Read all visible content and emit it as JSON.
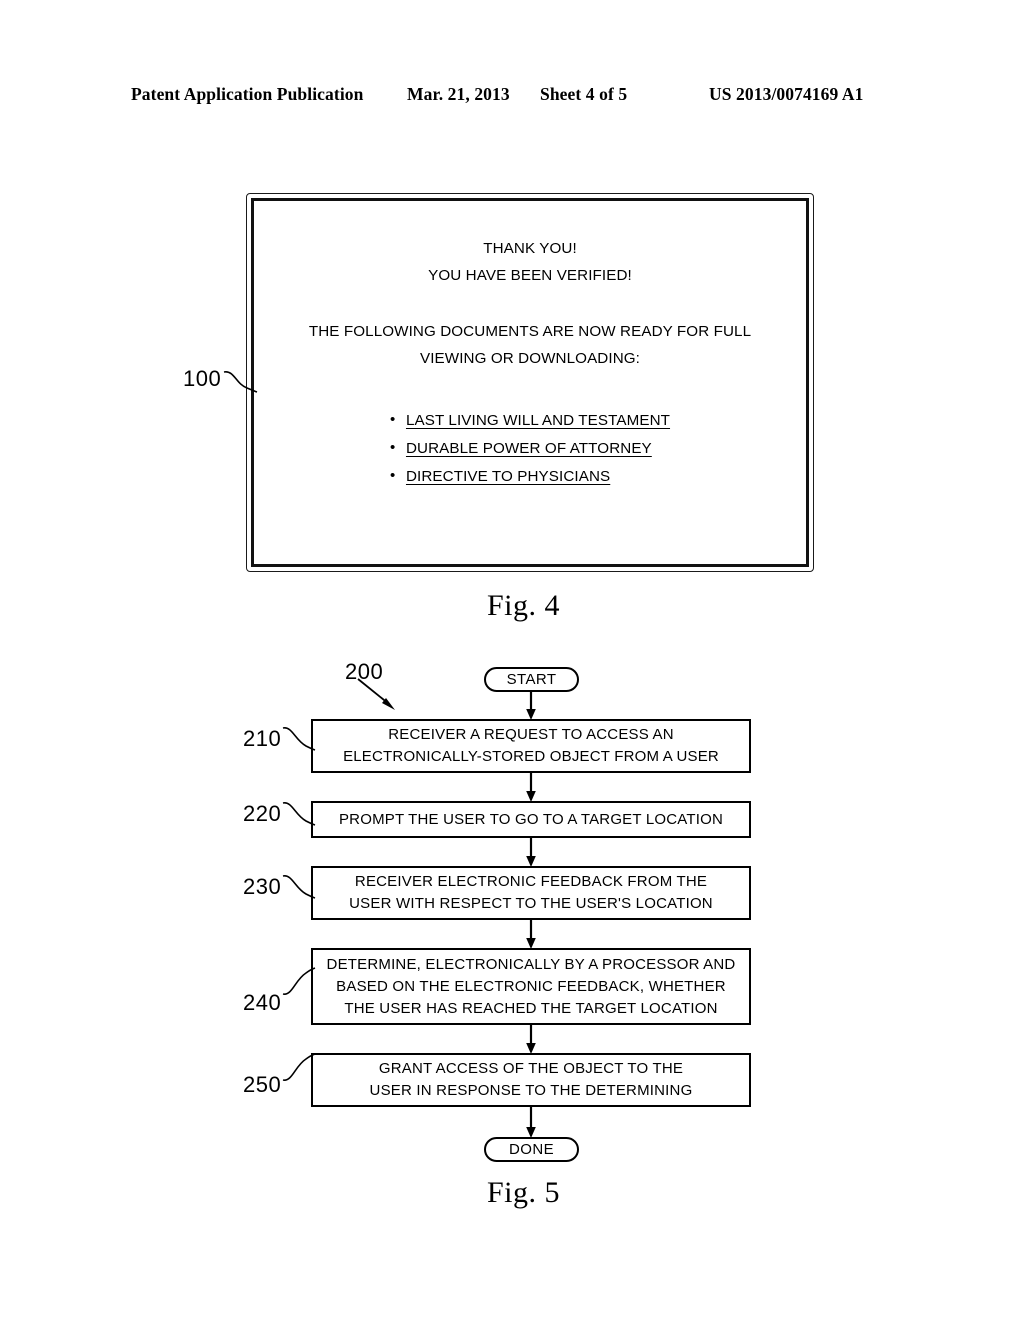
{
  "header": {
    "publication": "Patent Application Publication",
    "date": "Mar. 21, 2013",
    "sheet": "Sheet 4 of 5",
    "patent_number": "US 2013/0074169 A1"
  },
  "figure4": {
    "reference_numeral": "100",
    "caption": "Fig. 4",
    "dialog": {
      "line1": "THANK YOU!",
      "line2": "YOU HAVE BEEN VERIFIED!",
      "line3": "THE FOLLOWING DOCUMENTS ARE NOW READY FOR FULL",
      "line4": "VIEWING OR DOWNLOADING:",
      "documents": [
        "LAST LIVING WILL AND TESTAMENT",
        "DURABLE POWER OF ATTORNEY",
        "DIRECTIVE TO PHYSICIANS"
      ]
    }
  },
  "figure5": {
    "reference_numeral": "200",
    "caption": "Fig. 5",
    "start_label": "START",
    "done_label": "DONE",
    "steps": [
      {
        "ref": "210",
        "lines": [
          "RECEIVER A REQUEST TO ACCESS AN",
          "ELECTRONICALLY-STORED OBJECT FROM A USER"
        ]
      },
      {
        "ref": "220",
        "lines": [
          "PROMPT THE USER TO GO TO A TARGET LOCATION"
        ]
      },
      {
        "ref": "230",
        "lines": [
          "RECEIVER ELECTRONIC FEEDBACK FROM THE",
          "USER WITH RESPECT TO THE USER'S LOCATION"
        ]
      },
      {
        "ref": "240",
        "lines": [
          "DETERMINE, ELECTRONICALLY BY A PROCESSOR AND",
          "BASED ON THE ELECTRONIC FEEDBACK, WHETHER",
          "THE USER HAS REACHED THE TARGET LOCATION"
        ]
      },
      {
        "ref": "250",
        "lines": [
          "GRANT ACCESS OF THE OBJECT TO THE",
          "USER IN RESPONSE TO THE DETERMINING"
        ]
      }
    ]
  },
  "colors": {
    "ink": "#000000",
    "paper": "#ffffff"
  }
}
